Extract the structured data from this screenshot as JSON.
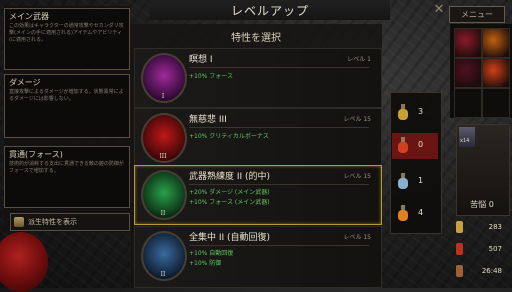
{
  "window": {
    "title": "レベルアップ",
    "close_glyph": "✕",
    "menu_label": "メニュー"
  },
  "left_panel": {
    "boxes": [
      {
        "title": "メイン武器",
        "text": "この効果はキャラクターの通常攻撃やセカンダリ攻撃(メインの手に適用される)アイテムやアビリティ(に適用される。"
      },
      {
        "title": "ダメージ",
        "text": "直接攻撃によるダメージが増加する。状態異常によるダメージには影響しない。"
      },
      {
        "title": "貫通(フォース)",
        "text": "技術的が消耗する支出に貫通できる敵の鎧の防御がフォースで増加する。"
      }
    ],
    "derive_button": "派生特性を表示"
  },
  "center": {
    "header": "特性を選択",
    "traits": [
      {
        "name": "瞑想 I",
        "level": "レベル 1",
        "rank": "I",
        "effects": [
          "+10% フォース"
        ],
        "color_inner": "#a02a9a",
        "color_outer": "#2a0830"
      },
      {
        "name": "無慈悲 III",
        "level": "レベル 15",
        "rank": "III",
        "effects": [
          "+10% クリティカルボーナス"
        ],
        "color_inner": "#c01818",
        "color_outer": "#3a0606"
      },
      {
        "name": "武器熟練度 II (的中)",
        "level": "レベル 15",
        "rank": "II",
        "effects": [
          "+20% ダメージ (メイン武器)",
          "+10% フォース (メイン武器)"
        ],
        "color_inner": "#2aa04a",
        "color_outer": "#0a2a12",
        "selected": true
      },
      {
        "name": "全集中 II (自動回復)",
        "level": "レベル 15",
        "rank": "II",
        "effects": [
          "+10% 自動回復",
          "+10% 防御"
        ],
        "color_inner": "#3a6aa0",
        "color_outer": "#0c1a2a"
      }
    ]
  },
  "potions": [
    {
      "count": "3",
      "color": "#c8a030",
      "highlight": false
    },
    {
      "count": "0",
      "color": "#d04020",
      "highlight": true
    },
    {
      "count": "1",
      "color": "#8ab0d0",
      "highlight": false
    },
    {
      "count": "4",
      "color": "#e08020",
      "highlight": false
    }
  ],
  "character": {
    "stack": "x14",
    "affliction": "苦悩 0"
  },
  "stats": [
    {
      "value": "283",
      "color": "#c8a040"
    },
    {
      "value": "507",
      "color": "#c03020"
    },
    {
      "value": "26:48",
      "color": "#a06030"
    }
  ],
  "skill_colors": [
    "#8a1a2a",
    "#c06010",
    "#501020",
    "#d04018"
  ]
}
